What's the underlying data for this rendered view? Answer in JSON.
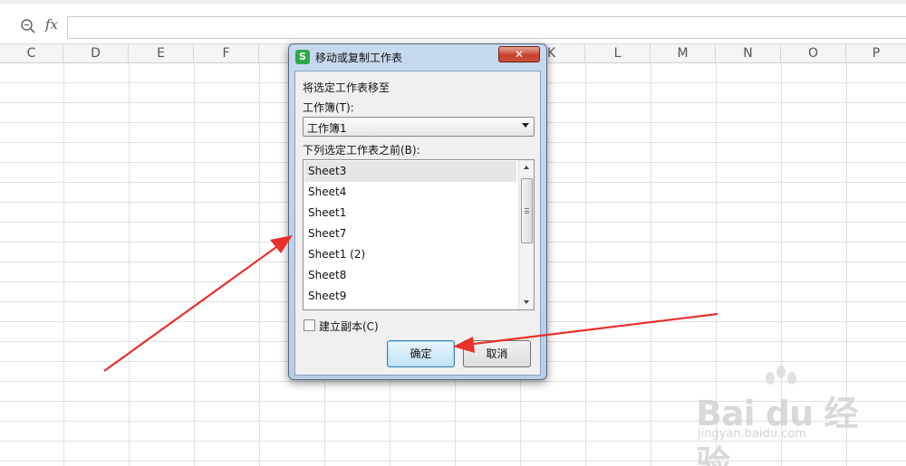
{
  "formula_bar": {
    "fx_label": "fx",
    "value": ""
  },
  "columns": [
    "C",
    "D",
    "E",
    "F",
    "K",
    "L",
    "M",
    "N",
    "O",
    "P"
  ],
  "dialog": {
    "app_icon": "S",
    "title": "移动或复制工作表",
    "close_label": "✕",
    "move_label": "将选定工作表移至",
    "workbook_label": "工作簿(T):",
    "workbook_value": "工作簿1",
    "before_label": "下列选定工作表之前(B):",
    "sheets": [
      "Sheet3",
      "Sheet4",
      "Sheet1",
      "Sheet7",
      "Sheet1 (2)",
      "Sheet8",
      "Sheet9"
    ],
    "selected_sheet": "Sheet3",
    "copy_label": "建立副本(C)",
    "copy_checked": false,
    "ok_label": "确定",
    "cancel_label": "取消"
  },
  "watermark": {
    "logo": "Bai du 经验",
    "sub": "jingyan.baidu.com"
  },
  "icons": {
    "zoom": "zoom-icon",
    "close": "close-icon",
    "arrow": "annotation-arrow"
  },
  "colors": {
    "annotation": "#e8302c",
    "title_bar": "#c7d9ee",
    "app_icon": "#2aa94a"
  }
}
